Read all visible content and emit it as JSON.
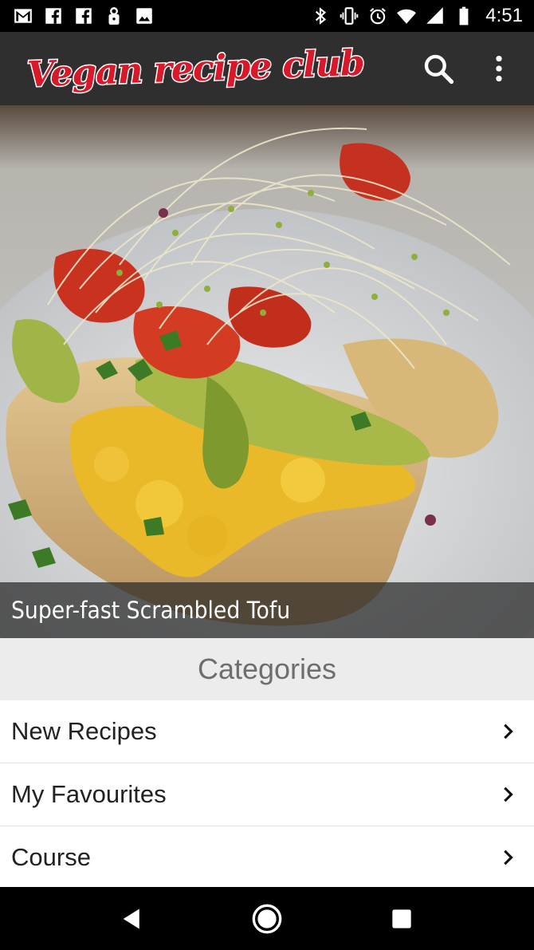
{
  "status_bar": {
    "time": "4:51",
    "icons_left": [
      "gmail-icon",
      "facebook-icon",
      "facebook-icon",
      "lock-icon",
      "image-icon"
    ],
    "icons_right": [
      "bluetooth-icon",
      "vibrate-icon",
      "alarm-icon",
      "wifi-icon",
      "signal-icon",
      "battery-icon"
    ]
  },
  "app_bar": {
    "logo_text": "Vegan recipe club",
    "brand_color": "#d9182a",
    "background": "#2f2f2f",
    "actions": [
      "search-icon",
      "more-vert-icon"
    ]
  },
  "hero": {
    "caption": "Super-fast Scrambled Tofu"
  },
  "categories": {
    "title": "Categories",
    "items": [
      {
        "label": "New Recipes"
      },
      {
        "label": "My Favourites"
      },
      {
        "label": "Course"
      }
    ]
  },
  "nav_bar": {
    "buttons": [
      "back-icon",
      "home-icon",
      "recents-icon"
    ]
  }
}
